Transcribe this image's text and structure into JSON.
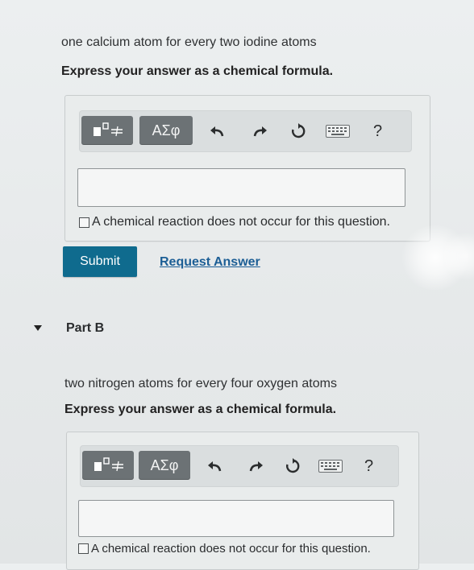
{
  "part_a": {
    "prompt": "one calcium atom for every two iodine atoms",
    "instruction": "Express your answer as a chemical formula.",
    "input_value": "",
    "no_reaction_label": "A chemical reaction does not occur for this question.",
    "submit_label": "Submit",
    "request_label": "Request Answer"
  },
  "toolbar": {
    "templates_icon": "templates-icon",
    "greek_label": "ΑΣφ",
    "undo_icon": "undo-icon",
    "redo_icon": "redo-icon",
    "reset_icon": "reset-icon",
    "keyboard_icon": "keyboard-icon",
    "help_label": "?"
  },
  "part_b": {
    "title": "Part B",
    "prompt": "two nitrogen atoms for every four oxygen atoms",
    "instruction": "Express your answer as a chemical formula.",
    "input_value": "",
    "no_reaction_label": "A chemical reaction does not occur for this question."
  },
  "colors": {
    "submit_bg": "#0f6b8e",
    "link": "#1c5e95",
    "toolbar_btn": "#6c7275"
  }
}
